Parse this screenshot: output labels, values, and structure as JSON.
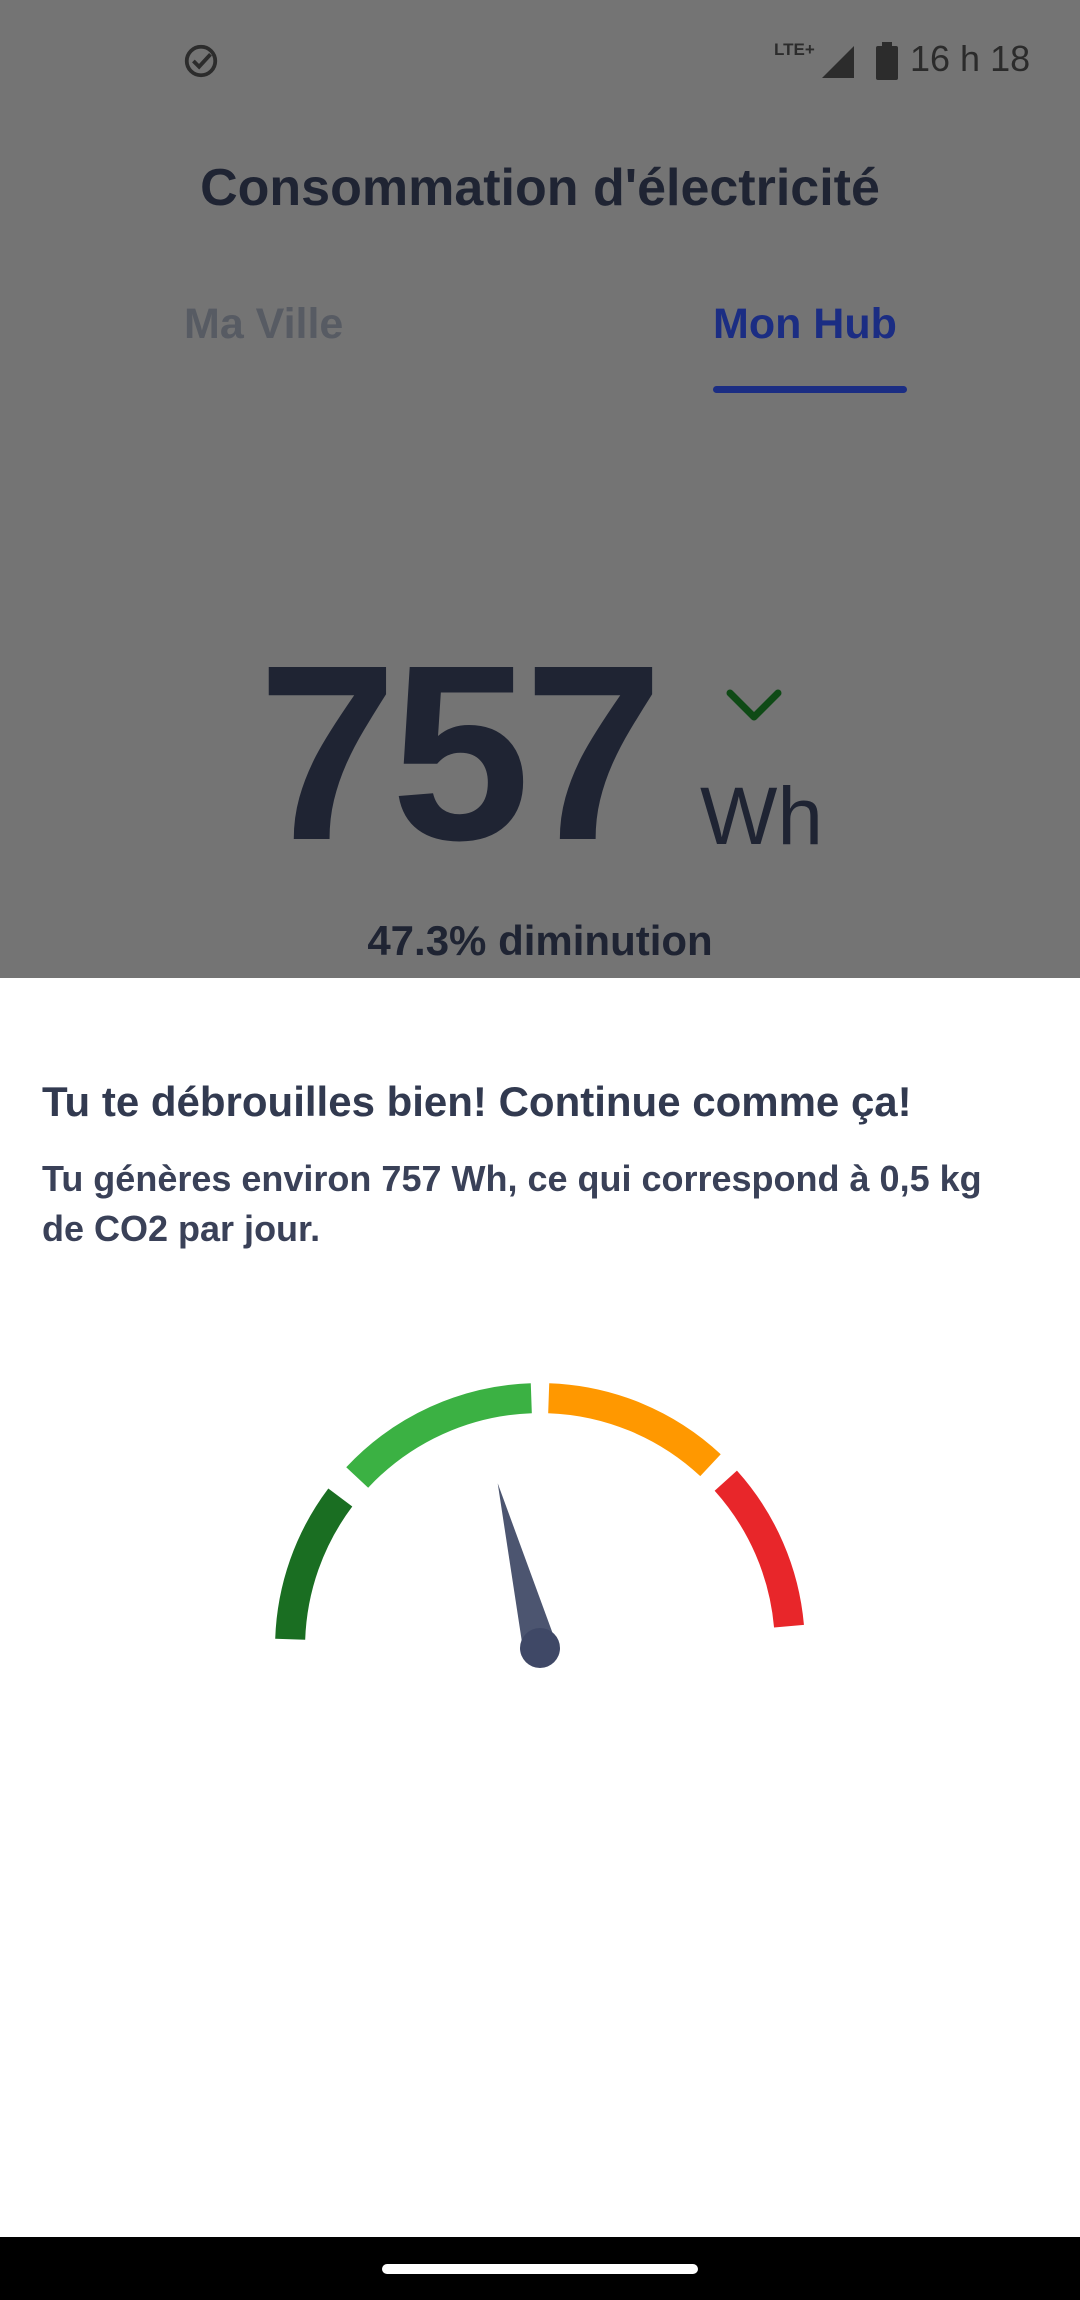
{
  "status_bar": {
    "network": "LTE+",
    "time": "16 h 18",
    "icons": [
      "check-circle-icon",
      "signal-icon",
      "battery-icon"
    ]
  },
  "header": {
    "title": "Consommation d'électricité"
  },
  "tabs": [
    {
      "label": "Ma Ville",
      "selected": false
    },
    {
      "label": "Mon Hub",
      "selected": true
    }
  ],
  "summary": {
    "value": "757",
    "unit": "Wh",
    "trend_icon": "chevron-down-icon",
    "change": "47.3% diminution"
  },
  "sheet": {
    "headline": "Tu te débrouilles bien! Continue comme ça!",
    "description": "Tu génères environ 757 Wh, ce qui correspond à 0,5 kg de CO2 par jour."
  },
  "gauge": {
    "segments": [
      {
        "color": "#1a6e22"
      },
      {
        "color": "#3bb143"
      },
      {
        "color": "#ff9800"
      },
      {
        "color": "#e8262a"
      }
    ],
    "needle_color": "#4c5570",
    "level_fraction": 0.42
  },
  "colors": {
    "accent": "#1b2d83",
    "overlay": "#747474",
    "text_dark": "#1f2433"
  }
}
